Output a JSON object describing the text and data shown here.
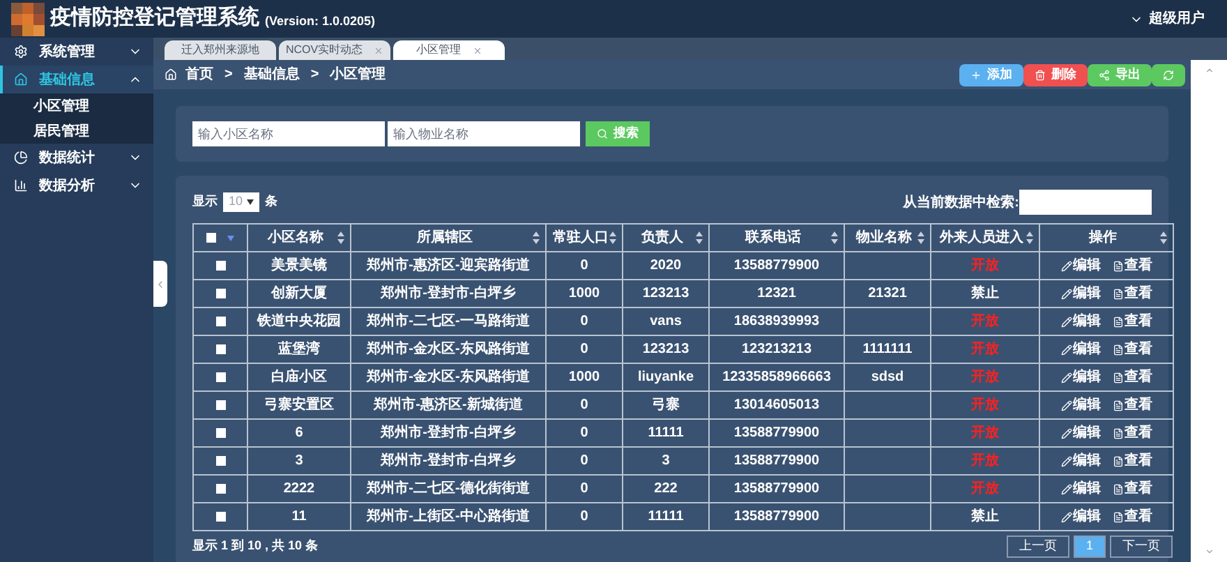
{
  "header": {
    "title": "疫情防控登记管理系统",
    "version": "(Version: 1.0.0205)",
    "user": "超级用户"
  },
  "sidebar": {
    "items": [
      {
        "label": "系统管理",
        "kind": "gear",
        "selected": false,
        "expanded": false
      },
      {
        "label": "基础信息",
        "kind": "home",
        "selected": true,
        "expanded": true,
        "children": [
          {
            "label": "小区管理"
          },
          {
            "label": "居民管理"
          }
        ]
      },
      {
        "label": "数据统计",
        "kind": "pie",
        "selected": false,
        "expanded": false
      },
      {
        "label": "数据分析",
        "kind": "chart",
        "selected": false,
        "expanded": false
      }
    ]
  },
  "tabs": [
    {
      "label": "迁入郑州来源地",
      "selected": false,
      "closable": false
    },
    {
      "label": "NCOV实时动态",
      "selected": false,
      "closable": true
    },
    {
      "label": "小区管理",
      "selected": true,
      "closable": true
    }
  ],
  "breadcrumb": [
    "首页",
    ">",
    "基础信息",
    ">",
    "小区管理"
  ],
  "toolbar": [
    {
      "kind": "add",
      "label": "添加"
    },
    {
      "kind": "delete",
      "label": "删除"
    },
    {
      "kind": "export",
      "label": "导出"
    },
    {
      "kind": "refresh"
    }
  ],
  "search": {
    "fields": [
      {
        "placeholder": "输入小区名称"
      },
      {
        "placeholder": "输入物业名称"
      }
    ],
    "button": "搜索"
  },
  "table": {
    "length_prefix": "显示",
    "length_value": "10",
    "length_suffix": "条",
    "filter_label": "从当前数据中检索:",
    "select_all_checked": false,
    "columns": [
      "小区名称",
      "所属辖区",
      "常驻人口",
      "负责人",
      "联系电话",
      "物业名称",
      "外来人员进入",
      "操作"
    ],
    "rows": [
      {
        "checked": false,
        "name": "美景美镜",
        "district": "郑州市-惠济区-迎宾路街道",
        "population": "0",
        "manager": "2020",
        "phone": "13588779900",
        "property": "",
        "outsider": "开放",
        "open": true,
        "actions": [
          "编辑",
          "查看"
        ]
      },
      {
        "checked": false,
        "name": "创新大厦",
        "district": "郑州市-登封市-白坪乡",
        "population": "1000",
        "manager": "123213",
        "phone": "12321",
        "property": "21321",
        "outsider": "禁止",
        "open": false,
        "actions": [
          "编辑",
          "查看"
        ]
      },
      {
        "checked": false,
        "name": "铁道中央花园",
        "district": "郑州市-二七区-一马路街道",
        "population": "0",
        "manager": "vans",
        "phone": "18638939993",
        "property": "",
        "outsider": "开放",
        "open": true,
        "actions": [
          "编辑",
          "查看"
        ]
      },
      {
        "checked": false,
        "name": "蓝堡湾",
        "district": "郑州市-金水区-东风路街道",
        "population": "0",
        "manager": "123213",
        "phone": "123213213",
        "property": "1111111",
        "outsider": "开放",
        "open": true,
        "actions": [
          "编辑",
          "查看"
        ]
      },
      {
        "checked": false,
        "name": "白庙小区",
        "district": "郑州市-金水区-东风路街道",
        "population": "1000",
        "manager": "liuyanke",
        "phone": "12335858966663",
        "property": "sdsd",
        "outsider": "开放",
        "open": true,
        "actions": [
          "编辑",
          "查看"
        ]
      },
      {
        "checked": false,
        "name": "弓寨安置区",
        "district": "郑州市-惠济区-新城街道",
        "population": "0",
        "manager": "弓寨",
        "phone": "13014605013",
        "property": "",
        "outsider": "开放",
        "open": true,
        "actions": [
          "编辑",
          "查看"
        ]
      },
      {
        "checked": false,
        "name": "6",
        "district": "郑州市-登封市-白坪乡",
        "population": "0",
        "manager": "11111",
        "phone": "13588779900",
        "property": "",
        "outsider": "开放",
        "open": true,
        "actions": [
          "编辑",
          "查看"
        ]
      },
      {
        "checked": false,
        "name": "3",
        "district": "郑州市-登封市-白坪乡",
        "population": "0",
        "manager": "3",
        "phone": "13588779900",
        "property": "",
        "outsider": "开放",
        "open": true,
        "actions": [
          "编辑",
          "查看"
        ]
      },
      {
        "checked": false,
        "name": "2222",
        "district": "郑州市-二七区-德化街街道",
        "population": "0",
        "manager": "222",
        "phone": "13588779900",
        "property": "",
        "outsider": "开放",
        "open": true,
        "actions": [
          "编辑",
          "查看"
        ]
      },
      {
        "checked": false,
        "name": "11",
        "district": "郑州市-上街区-中心路街道",
        "population": "0",
        "manager": "11111",
        "phone": "13588779900",
        "property": "",
        "outsider": "禁止",
        "open": false,
        "actions": [
          "编辑",
          "查看"
        ]
      }
    ],
    "info": "显示 1 到 10 , 共 10 条",
    "pager": [
      {
        "label": "上一页",
        "selected": false
      },
      {
        "label": "1",
        "selected": true
      },
      {
        "label": "下一页",
        "selected": false
      }
    ]
  }
}
